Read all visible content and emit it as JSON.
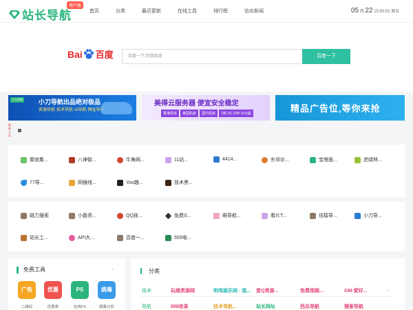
{
  "logo": {
    "text": "站长导航",
    "badge": "用户版"
  },
  "nav": [
    "首页",
    "分类",
    "最近更新",
    "在线工具",
    "排行榜",
    "站长新闻"
  ],
  "clock": {
    "month": "05",
    "month_unit": "月",
    "day": "22",
    "time": "15:50:52 周五"
  },
  "search": {
    "logo_left": "Bai",
    "logo_right": "百度",
    "placeholder": "百度一下,你就知道",
    "button": "百度一下"
  },
  "banners": [
    {
      "title": "小刀导航出品绝对极品",
      "subtitle": "资源导航·技术导航·AI导航·网址导航",
      "mini": "小刀导航"
    },
    {
      "title": "美得云服务器 便宜安全稳定",
      "tags": [
        "香港机房",
        "美国机房",
        "国内机房",
        "2核 2G 20M 10元起"
      ]
    },
    {
      "title": "精品广告位,等你来抢"
    }
  ],
  "notice": {
    "vertical": [
      "最",
      "新",
      "公",
      "告"
    ]
  },
  "sites_row1": [
    {
      "label": "聚收集...",
      "color": "#6cc36a"
    },
    {
      "label": "八神智...",
      "color": "#b03a2e"
    },
    {
      "label": "牛角网...",
      "color": "#d0463b"
    },
    {
      "label": "11站...",
      "color": "#c9a5e8"
    },
    {
      "label": "4414...",
      "color": "#2b7bd1"
    },
    {
      "label": "东坝论...",
      "color": "#e07b2d"
    },
    {
      "label": "宝塔面...",
      "color": "#2ab57d"
    },
    {
      "label": "虎绿林...",
      "color": "#9ac23c"
    }
  ],
  "sites_row2": [
    {
      "label": "77导...",
      "color": "#2b8fe0"
    },
    {
      "label": "网猴线...",
      "color": "#e8a53a"
    },
    {
      "label": "Yoo趣...",
      "color": "#222222"
    },
    {
      "label": "技术黑...",
      "color": "#3a2414"
    }
  ],
  "sites_row3": [
    {
      "label": "磁力搜索",
      "color": "#8b7a6a"
    },
    {
      "label": "小磊资...",
      "color": "#8b7a6a"
    },
    {
      "label": "QQ技...",
      "color": "#d0463b"
    },
    {
      "label": "免费S...",
      "color": "#333333"
    },
    {
      "label": "萌导航...",
      "color": "#f0a8c0"
    },
    {
      "label": "看片T...",
      "color": "#c9a5e8"
    },
    {
      "label": "炫猿导...",
      "color": "#8b7a6a"
    },
    {
      "label": "小刀导...",
      "color": "#2b7bd1"
    }
  ],
  "sites_row4": [
    {
      "label": "站长工...",
      "color": "#b8732e"
    },
    {
      "label": "API大...",
      "color": "#e85a9a"
    },
    {
      "label": "百度一...",
      "color": "#8b7a6a"
    },
    {
      "label": "555电...",
      "color": "#2e8b57"
    }
  ],
  "tools": {
    "title": "免费工具",
    "items": [
      {
        "icon": "广告",
        "label": "二维码",
        "color": "#f5a623"
      },
      {
        "icon": "优惠",
        "label": "优惠券",
        "color": "#ef5350"
      },
      {
        "icon": "PS",
        "label": "在线PS",
        "color": "#2ab57d"
      },
      {
        "icon": "病毒",
        "label": "病毒分析",
        "color": "#3a9bea"
      }
    ]
  },
  "categories": {
    "title": "分类",
    "rows": [
      {
        "label": "技术",
        "links": [
          {
            "text": "玩维资源网",
            "color": "#e0457a"
          },
          {
            "text": "明鸡娱乐网 - 我...",
            "color": "#2ab5b5"
          },
          {
            "text": "爱Q资源...",
            "color": "#e0457a"
          },
          {
            "text": "免费视频...",
            "color": "#e0457a"
          },
          {
            "text": "GM-爱好...",
            "color": "#e0457a"
          }
        ]
      },
      {
        "label": "导航",
        "links": [
          {
            "text": "888收录",
            "color": "#e0457a"
          },
          {
            "text": "技术导航...",
            "color": "#e0a030"
          },
          {
            "text": "站长网址",
            "color": "#2ab57d"
          },
          {
            "text": "西瓜导航",
            "color": "#e0457a"
          },
          {
            "text": "搜索导航",
            "color": "#e0457a"
          }
        ]
      }
    ]
  }
}
